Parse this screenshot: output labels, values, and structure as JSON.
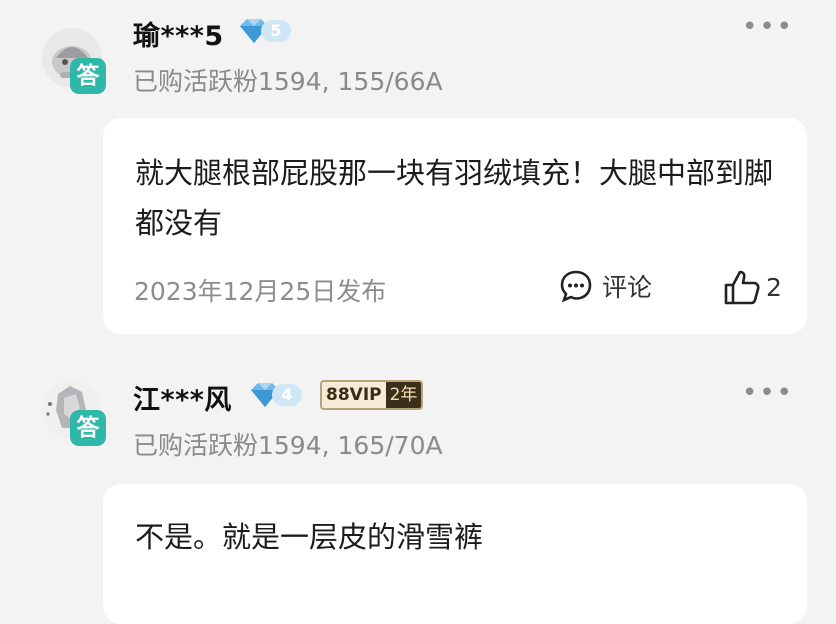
{
  "answers": [
    {
      "username": "瑜***5",
      "level": "5",
      "badge_label": "答",
      "purchase_info": "已购活跃粉1594, 155/66A",
      "content": "就大腿根部屁股那一块有羽绒填充！大腿中部到脚都没有",
      "date": "2023年12月25日发布",
      "comment_label": "评论",
      "like_count": "2",
      "more_icon": "more-dots-icon"
    },
    {
      "username": "江***风",
      "level": "4",
      "badge_label": "答",
      "vip_label": "88VIP",
      "vip_years": "2年",
      "purchase_info": "已购活跃粉1594, 165/70A",
      "content": "不是。就是一层皮的滑雪裤",
      "more_icon": "more-dots-icon"
    }
  ],
  "colors": {
    "background": "#f3f3f4",
    "badge": "#2fb7a8",
    "gem": "#6fb9ea",
    "vip_gold": "#b9a27a"
  }
}
